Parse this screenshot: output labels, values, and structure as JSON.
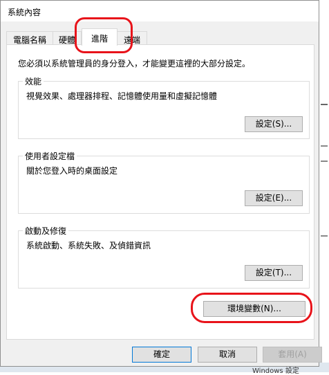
{
  "window": {
    "title": "系統內容"
  },
  "tabs": [
    {
      "label": "電腦名稱",
      "selected": false
    },
    {
      "label": "硬體",
      "selected": false
    },
    {
      "label": "進階",
      "selected": true
    },
    {
      "label": "遠端",
      "selected": false
    }
  ],
  "admin_note": "您必須以系統管理員的身分登入，才能變更這裡的大部分設定。",
  "performance": {
    "title": "效能",
    "description": "視覺效果、處理器排程、記憶體使用量和虛擬記憶體",
    "settings_label": "設定(S)..."
  },
  "user_profiles": {
    "title": "使用者設定檔",
    "description": "關於您登入時的桌面設定",
    "settings_label": "設定(E)..."
  },
  "startup_recovery": {
    "title": "啟動及修復",
    "description": "系統啟動、系統失敗、及偵錯資訊",
    "settings_label": "設定(T)..."
  },
  "env_vars_label": "環境變數(N)...",
  "footer": {
    "ok_label": "確定",
    "cancel_label": "取消",
    "apply_label": "套用(A)"
  },
  "background": {
    "partial_text": "Windows 設定"
  },
  "annotation_color": "#e8131a"
}
